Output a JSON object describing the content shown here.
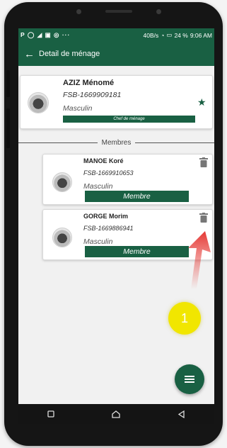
{
  "status_bar": {
    "left_icons": "P ◯ ◢ ▣ ◎ ··· ",
    "speed": "40B/s",
    "battery": "24 %",
    "time": "9:06 AM"
  },
  "app_bar": {
    "back_icon": "arrow-left-icon",
    "title": "Detail de ménage"
  },
  "head": {
    "name": "AZIZ Ménomé",
    "code": "FSB-1669909181",
    "gender": "Masculin",
    "role": "Chef de ménage",
    "star_icon": "star-icon"
  },
  "members_label": "Membres",
  "members": [
    {
      "name": "MANOE Koré",
      "code": "FSB-1669910653",
      "gender": "Masculin",
      "role": "Membre"
    },
    {
      "name": "GORGE Morim",
      "code": "FSB-1669886941",
      "gender": "Masculin",
      "role": "Membre"
    }
  ],
  "annotation": {
    "step_number": "1"
  },
  "colors": {
    "primary": "#196043",
    "annotation_arrow": "#e53935",
    "annotation_badge": "#f1e600"
  }
}
